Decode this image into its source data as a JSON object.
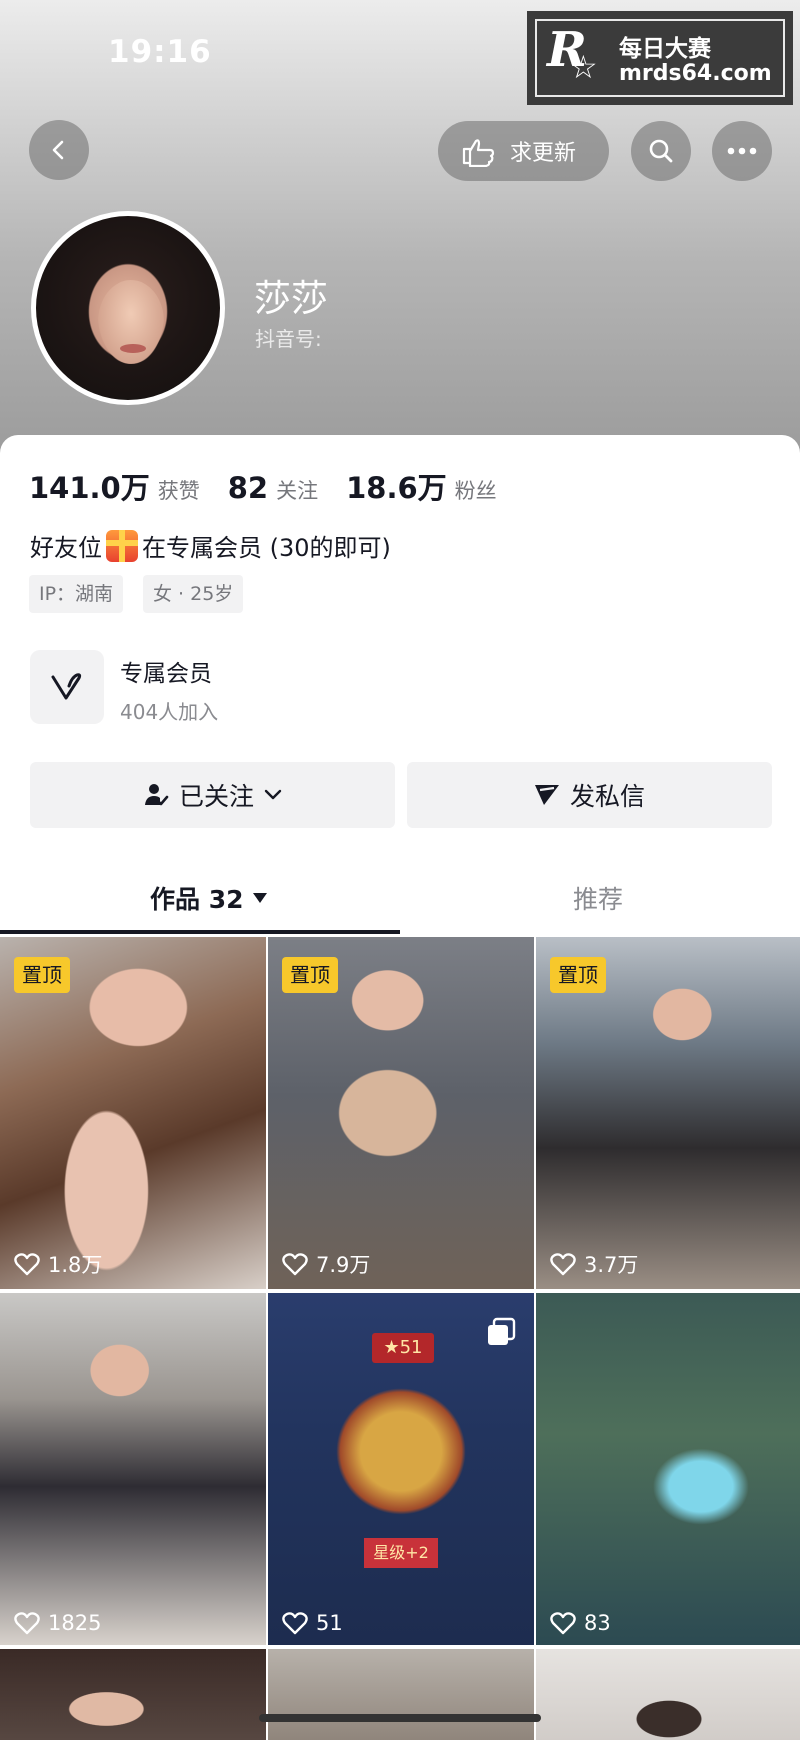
{
  "status": {
    "time": "19:16"
  },
  "watermark": {
    "line1": "每日大赛",
    "line2": "mrds64.com"
  },
  "topbar": {
    "update_label": "求更新"
  },
  "profile": {
    "name": "莎莎",
    "id_label": "抖音号:"
  },
  "stats": [
    {
      "value": "141.0万",
      "label": "获赞"
    },
    {
      "value": "82",
      "label": "关注"
    },
    {
      "value": "18.6万",
      "label": "粉丝"
    }
  ],
  "bio": {
    "before": "好友位",
    "after": "在专属会员 (30的即可)"
  },
  "tags": {
    "ip": "IP：湖南",
    "gender_age": "女 · 25岁"
  },
  "membership": {
    "title": "专属会员",
    "count": "404人加入"
  },
  "actions": {
    "followed": "已关注",
    "message": "发私信"
  },
  "tabs": {
    "works": "作品 32",
    "recommend": "推荐"
  },
  "grid": [
    {
      "pinned": true,
      "pin_label": "置顶",
      "likes": "1.8万"
    },
    {
      "pinned": true,
      "pin_label": "置顶",
      "likes": "7.9万"
    },
    {
      "pinned": true,
      "pin_label": "置顶",
      "likes": "3.7万"
    },
    {
      "pinned": false,
      "likes": "1825"
    },
    {
      "pinned": false,
      "likes": "51",
      "badge": "★51",
      "stage": "星级+2"
    },
    {
      "pinned": false,
      "likes": "83"
    }
  ],
  "colors": {
    "pin_bg": "#f7c82b",
    "text_primary": "#161823",
    "text_secondary": "#8a8b90"
  }
}
